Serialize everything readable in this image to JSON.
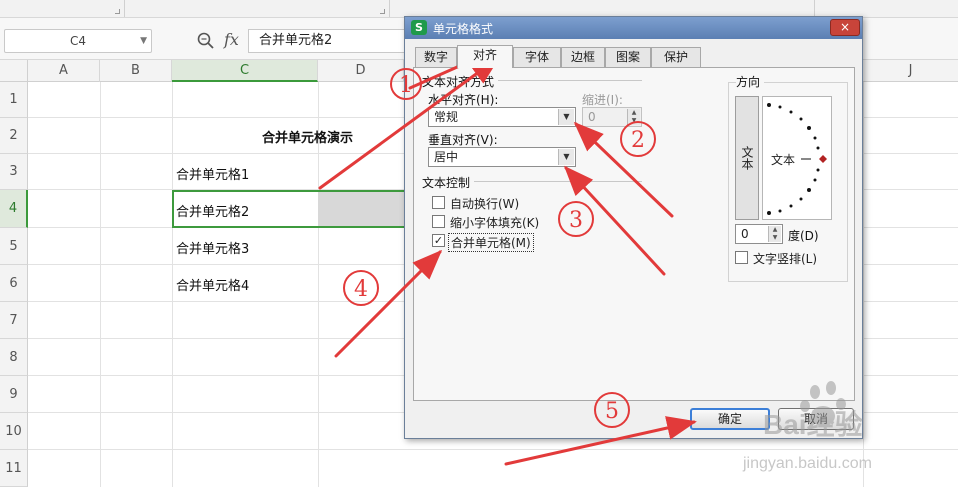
{
  "formula_bar": {
    "name_box": "C4",
    "formula": "合并单元格2"
  },
  "columns": [
    "A",
    "B",
    "C",
    "D",
    "J"
  ],
  "rows": [
    "1",
    "2",
    "3",
    "4",
    "5",
    "6",
    "7",
    "8",
    "9",
    "10",
    "11"
  ],
  "active_cell": {
    "column": "C",
    "row": "4"
  },
  "cells": {
    "c2": "合并单元格演示",
    "c3": "合并单元格1",
    "c4": "合并单元格2",
    "c5": "合并单元格3",
    "c6": "合并单元格4"
  },
  "dialog": {
    "title": "单元格格式",
    "close": "×",
    "tabs": [
      "数字",
      "对齐",
      "字体",
      "边框",
      "图案",
      "保护"
    ],
    "active_tab": "对齐",
    "text_alignment_group": "文本对齐方式",
    "horizontal_label": "水平对齐(H):",
    "horizontal_value": "常规",
    "indent_label": "缩进(I):",
    "indent_value": "0",
    "vertical_label": "垂直对齐(V):",
    "vertical_value": "居中",
    "text_control_group": "文本控制",
    "checkboxes": [
      {
        "label": "自动换行(W)",
        "checked": false
      },
      {
        "label": "缩小字体填充(K)",
        "checked": false
      },
      {
        "label": "合并单元格(M)",
        "checked": true
      }
    ],
    "direction_group": "方向",
    "vertical_text_button": "文本",
    "orientation_label": "文本",
    "degree_value": "0",
    "degree_label": "度(D)",
    "vertical_layout_checkbox": "文字竖排(L)",
    "ok_button": "确定",
    "cancel_button": "取消"
  },
  "annotations": {
    "numbers": [
      "①",
      "②",
      "③",
      "④",
      "⑤"
    ],
    "arrow_color": "#e23a3a"
  },
  "watermark": {
    "brand": "Bai经验",
    "domain": "jingyan.baidu.com"
  }
}
